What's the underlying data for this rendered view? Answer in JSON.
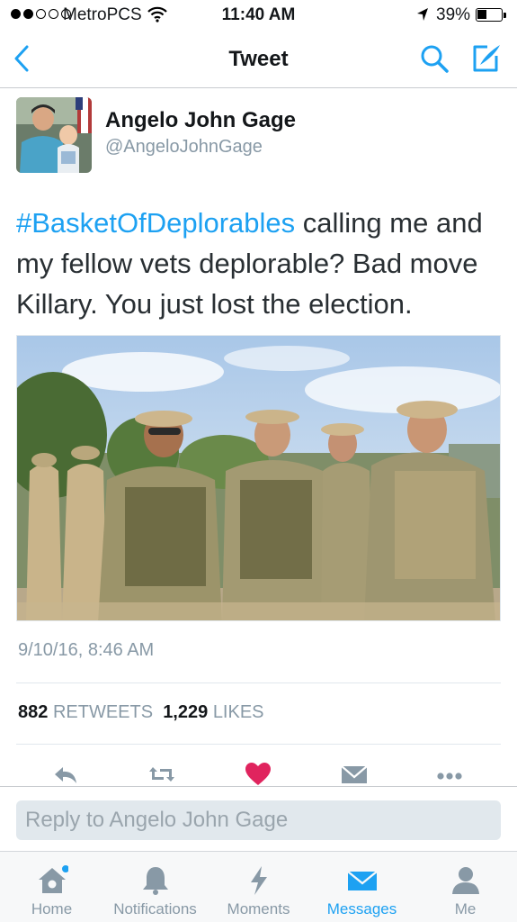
{
  "status_bar": {
    "carrier": "MetroPCS",
    "time": "11:40 AM",
    "battery": "39%",
    "signal_bars_filled": 2,
    "signal_bars_total": 5
  },
  "nav": {
    "title": "Tweet",
    "back_icon": "chevron-left-icon",
    "search_icon": "search-icon",
    "compose_icon": "compose-icon"
  },
  "tweet": {
    "author_name": "Angelo John Gage",
    "author_handle": "@AngeloJohnGage",
    "hashtag": "#BasketOfDeplorables",
    "text": " calling me and my fellow vets deplorable? Bad move Killary. You just lost the election.",
    "timestamp": "9/10/16, 8:46 AM",
    "retweets_count": "882",
    "retweets_label": "RETWEETS",
    "likes_count": "1,229",
    "likes_label": "LIKES",
    "liked": true
  },
  "actions": {
    "reply_icon": "reply-icon",
    "retweet_icon": "retweet-icon",
    "like_icon": "heart-icon",
    "dm_icon": "direct-message-icon",
    "more_icon": "more-icon"
  },
  "reply": {
    "placeholder": "Reply to Angelo John Gage"
  },
  "tabbar": {
    "tabs": [
      {
        "label": "Home",
        "icon": "home-icon",
        "active": false,
        "badge": true
      },
      {
        "label": "Notifications",
        "icon": "bell-icon",
        "active": false
      },
      {
        "label": "Moments",
        "icon": "lightning-icon",
        "active": false
      },
      {
        "label": "Messages",
        "icon": "envelope-icon",
        "active": true
      },
      {
        "label": "Me",
        "icon": "person-icon",
        "active": false
      }
    ]
  },
  "colors": {
    "accent": "#1da1f2",
    "like": "#e0245e",
    "muted": "#8899a6",
    "icon_gray": "#8899a6"
  }
}
